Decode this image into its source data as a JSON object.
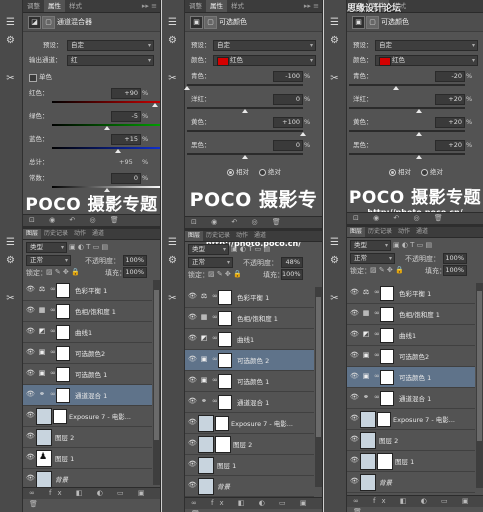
{
  "watermark": "思缘设计论坛 www.MISSYUAN.COM",
  "panel1": {
    "tabs": [
      "调整",
      "属性",
      "样式"
    ],
    "title": "通道混合器",
    "preset_label": "预设：",
    "preset_value": "自定",
    "output_label": "输出通道：",
    "output_value": "红",
    "mono_label": "单色",
    "red_label": "红色：",
    "red_value": "+90",
    "green_label": "绿色：",
    "green_value": "-5",
    "blue_label": "蓝色：",
    "blue_value": "+15",
    "total_label": "总计：",
    "total_value": "+95",
    "const_label": "常数：",
    "const_value": "0",
    "pct": "%"
  },
  "panel2": {
    "tabs": [
      "调整",
      "属性",
      "样式"
    ],
    "title": "可选颜色",
    "preset_label": "预设：",
    "preset_value": "自定",
    "color_label": "颜色：",
    "color_value": "红色",
    "cyan_label": "青色：",
    "cyan_value": "-100",
    "magenta_label": "洋红：",
    "magenta_value": "0",
    "yellow_label": "黄色：",
    "yellow_value": "+100",
    "black_label": "黑色：",
    "black_value": "0",
    "relative_label": "相对",
    "absolute_label": "绝对",
    "pct": "%"
  },
  "panel3": {
    "tabs": [
      "调整",
      "属性",
      "样式"
    ],
    "title": "可选颜色",
    "preset_label": "预设：",
    "preset_value": "自定",
    "color_label": "颜色：",
    "color_value": "红色",
    "cyan_label": "青色：",
    "cyan_value": "-20",
    "magenta_label": "洋红：",
    "magenta_value": "+20",
    "yellow_label": "黄色：",
    "yellow_value": "+20",
    "black_label": "黑色：",
    "black_value": "+20",
    "relative_label": "相对",
    "absolute_label": "绝对",
    "pct": "%"
  },
  "logo": {
    "big": "POCO 摄影专题",
    "url": "http://photo.poco.cn/"
  },
  "layers_panel": {
    "tabs": [
      "图层",
      "历史记录",
      "动作",
      "通道"
    ],
    "kind": "类型",
    "blend": "正常",
    "opacity_label": "不透明度：",
    "lock_label": "锁定：",
    "fill_label": "填充："
  },
  "layers1": {
    "opacity": "100%",
    "fill": "100%",
    "items": [
      "色彩平衡 1",
      "色相/饱和度 1",
      "曲线1",
      "可选颜色2",
      "可选颜色 1",
      "通道混合 1",
      "Exposure 7 - 电影...",
      "图层 2",
      "图层 1",
      "背景"
    ]
  },
  "layers2": {
    "opacity": "48%",
    "fill": "100%",
    "items": [
      "色彩平衡 1",
      "色相/饱和度 1",
      "曲线1",
      "可选颜色 2",
      "可选颜色 1",
      "通道混合 1",
      "Exposure 7 - 电影...",
      "图层 2",
      "图层 1",
      "背景"
    ]
  },
  "layers3": {
    "opacity": "100%",
    "fill": "100%",
    "items": [
      "色彩平衡 1",
      "色相/饱和度 1",
      "曲线1",
      "可选颜色2",
      "可选颜色 1",
      "通道混合 1",
      "Exposure 7 - 电影...",
      "图层 2",
      "图层 1",
      "背景"
    ]
  },
  "bottom_icons": "∞ fx ◧ ◐ ▭ ▣ 🗑"
}
